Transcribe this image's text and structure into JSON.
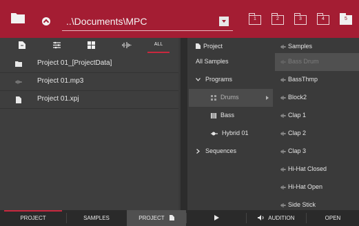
{
  "topbar": {
    "path": "..\\Documents\\MPC",
    "recent_locations": [
      "1",
      "2",
      "3",
      "4",
      "5"
    ],
    "folder_icon": "folder-icon",
    "up_icon": "up-arrow-icon",
    "dropdown_icon": "dropdown-icon"
  },
  "filters": {
    "all_label": "ALL",
    "icons": [
      "project-file-icon",
      "program-icon",
      "pad-grid-icon",
      "waveform-icon"
    ]
  },
  "files": [
    {
      "icon": "folder-icon",
      "name": "Project 01_[ProjectData]"
    },
    {
      "icon": "audio-icon",
      "name": "Project 01.mp3"
    },
    {
      "icon": "project-file-icon",
      "name": "Project 01.xpj"
    }
  ],
  "middle": {
    "header": "Project",
    "all_samples": "All Samples",
    "programs": "Programs",
    "drums": "Drums",
    "bass": "Bass",
    "hybrid": "Hybrid 01",
    "sequences": "Sequences"
  },
  "right": {
    "header": "Samples",
    "samples": [
      "Bass Drum",
      "BassThmp",
      "Block2",
      "Clap 1",
      "Clap 2",
      "Clap 3",
      "Hi-Hat Closed",
      "Hi-Hat Open",
      "Side Stick"
    ],
    "selected_index": 0
  },
  "bottom": {
    "project": "PROJECT",
    "samples": "SAMPLES",
    "project_load": "PROJECT",
    "audition": "AUDITION",
    "open": "OPEN"
  },
  "colors": {
    "accent": "#a41d33",
    "highlight": "#c9283e"
  }
}
